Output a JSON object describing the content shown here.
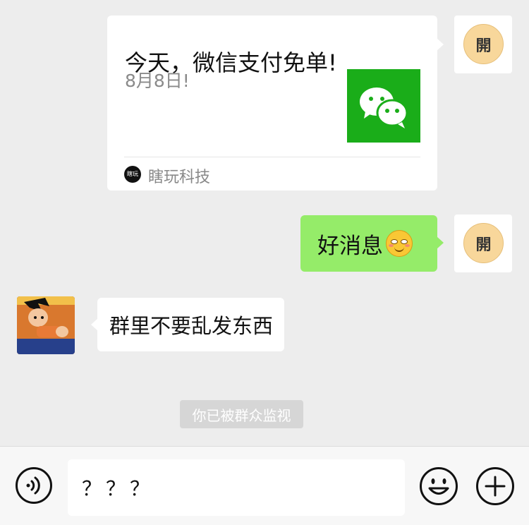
{
  "messages": {
    "link_card": {
      "title": "今天，微信支付免单!",
      "description": "8月8日!",
      "source_icon_text": "瞎玩",
      "source": "瞎玩科技",
      "thumbnail_icon": "wechat-logo-icon",
      "thumbnail_color": "#1aad19"
    },
    "sent_text": {
      "text": "好消息",
      "emoji": "blush-smile-emoji-icon"
    },
    "received_text": {
      "text": "群里不要乱发东西",
      "avatar": "cartoon-avatar"
    },
    "self_avatar_text": "開"
  },
  "system_notice": "你已被群众监视",
  "input_bar": {
    "text": "？？？",
    "voice_icon": "voice-icon",
    "emoji_icon": "emoji-icon",
    "plus_icon": "plus-icon"
  },
  "colors": {
    "background": "#ededed",
    "sent_bubble": "#95ec69",
    "received_bubble": "#ffffff",
    "avatar_badge": "#f8d79b"
  }
}
